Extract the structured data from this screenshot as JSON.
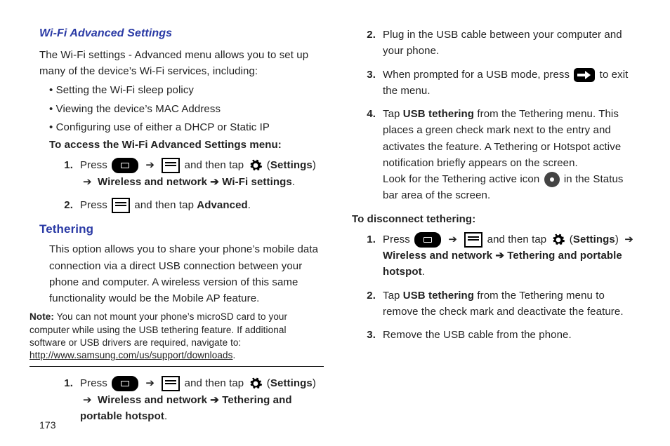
{
  "page_number": "173",
  "left": {
    "h_wifi": "Wi-Fi Advanced Settings",
    "wifi_intro": "The Wi-Fi settings - Advanced menu allows you to set up many of the device’s Wi-Fi services, including:",
    "b1": "Setting the Wi-Fi sleep policy",
    "b2": "Viewing the device’s MAC Address",
    "b3": "Configuring use of either a DHCP or Static IP",
    "access_label": "To access the Wi-Fi Advanced Settings menu:",
    "s1": {
      "num": "1.",
      "press": "Press ",
      "then_tap": " and then tap ",
      "settings": "Settings",
      "chain": "Wireless and network ➔ Wi-Fi settings",
      "period": "."
    },
    "s2": {
      "num": "2.",
      "press": "Press ",
      "then_tap": " and then tap ",
      "adv": "Advanced",
      "period": "."
    },
    "h_tether": "Tethering",
    "tether_p": "This option allows you to share your phone’s mobile data connection via a direct USB connection between your phone and computer. A wireless version of this same functionality would be the Mobile AP feature.",
    "note_lbl": "Note:",
    "note_body": " You can not mount your phone’s microSD card to your computer while using the USB tethering feature. If additional software or USB drivers are required, navigate to: ",
    "note_link": "http://www.samsung.com/us/support/downloads",
    "note_period": ".",
    "t1": {
      "num": "1.",
      "press": "Press ",
      "then_tap": " and then tap ",
      "settings": "Settings",
      "chain": "Wireless and network ➔ Tethering and portable hotspot",
      "period": "."
    }
  },
  "right": {
    "r2": {
      "num": "2.",
      "txt": "Plug in the USB cable between your computer and your phone."
    },
    "r3": {
      "num": "3.",
      "a": "When prompted for a USB mode, press ",
      "b": " to exit the menu."
    },
    "r4": {
      "num": "4.",
      "a": "Tap ",
      "usb": "USB tethering",
      "b": " from the Tethering menu. This places a green check mark next to the entry and activates the feature. A Tethering or Hotspot active notification briefly appears on the screen.",
      "c": "Look for the Tethering active icon ",
      "d": " in the Status bar area of the screen."
    },
    "disc_lbl": "To disconnect tethering:",
    "d1": {
      "num": "1.",
      "press": "Press ",
      "then_tap": " and then tap ",
      "settings": "Settings",
      "chain": "Wireless and network ➔ Tethering and portable hotspot",
      "period": "."
    },
    "d2": {
      "num": "2.",
      "a": "Tap ",
      "usb": "USB tethering",
      "b": " from the Tethering menu to remove the check mark and deactivate the feature."
    },
    "d3": {
      "num": "3.",
      "txt": "Remove the USB cable from the phone."
    }
  },
  "glyph": {
    "arrow": "➔"
  }
}
